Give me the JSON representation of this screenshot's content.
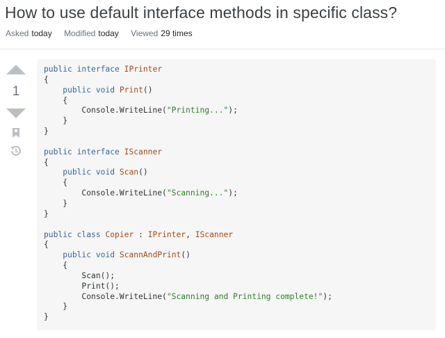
{
  "question": {
    "title": "How to use default interface methods in specific class?",
    "meta": {
      "asked_label": "Asked",
      "asked_value": "today",
      "modified_label": "Modified",
      "modified_value": "today",
      "viewed_label": "Viewed",
      "viewed_value": "29 times"
    },
    "votes": {
      "score": "1"
    },
    "colors": {
      "keyword": "#39659b",
      "type": "#a24a18",
      "string": "#2f7d2a",
      "code_bg": "#f6f6f6"
    },
    "code_lines": [
      [
        [
          "kw",
          "public"
        ],
        [
          "p",
          " "
        ],
        [
          "kw",
          "interface"
        ],
        [
          "p",
          " "
        ],
        [
          "ty",
          "IPrinter"
        ]
      ],
      [
        [
          "p",
          "{"
        ]
      ],
      [
        [
          "p",
          "    "
        ],
        [
          "kw",
          "public"
        ],
        [
          "p",
          " "
        ],
        [
          "kw",
          "void"
        ],
        [
          "p",
          " "
        ],
        [
          "ty",
          "Print"
        ],
        [
          "p",
          "()"
        ]
      ],
      [
        [
          "p",
          "    {"
        ]
      ],
      [
        [
          "p",
          "        Console.WriteLine("
        ],
        [
          "st",
          "\"Printing...\""
        ],
        [
          "p",
          ");"
        ]
      ],
      [
        [
          "p",
          "    }"
        ]
      ],
      [
        [
          "p",
          "}"
        ]
      ],
      [],
      [
        [
          "kw",
          "public"
        ],
        [
          "p",
          " "
        ],
        [
          "kw",
          "interface"
        ],
        [
          "p",
          " "
        ],
        [
          "ty",
          "IScanner"
        ]
      ],
      [
        [
          "p",
          "{"
        ]
      ],
      [
        [
          "p",
          "    "
        ],
        [
          "kw",
          "public"
        ],
        [
          "p",
          " "
        ],
        [
          "kw",
          "void"
        ],
        [
          "p",
          " "
        ],
        [
          "ty",
          "Scan"
        ],
        [
          "p",
          "()"
        ]
      ],
      [
        [
          "p",
          "    {"
        ]
      ],
      [
        [
          "p",
          "        Console.WriteLine("
        ],
        [
          "st",
          "\"Scanning...\""
        ],
        [
          "p",
          ");"
        ]
      ],
      [
        [
          "p",
          "    }"
        ]
      ],
      [
        [
          "p",
          "}"
        ]
      ],
      [],
      [
        [
          "kw",
          "public"
        ],
        [
          "p",
          " "
        ],
        [
          "kw",
          "class"
        ],
        [
          "p",
          " "
        ],
        [
          "ty",
          "Copier"
        ],
        [
          "p",
          " : "
        ],
        [
          "ty",
          "IPrinter"
        ],
        [
          "p",
          ", "
        ],
        [
          "ty",
          "IScanner"
        ]
      ],
      [
        [
          "p",
          "{"
        ]
      ],
      [
        [
          "p",
          "    "
        ],
        [
          "kw",
          "public"
        ],
        [
          "p",
          " "
        ],
        [
          "kw",
          "void"
        ],
        [
          "p",
          " "
        ],
        [
          "ty",
          "ScannAndPrint"
        ],
        [
          "p",
          "()"
        ]
      ],
      [
        [
          "p",
          "    {"
        ]
      ],
      [
        [
          "p",
          "        Scan();"
        ]
      ],
      [
        [
          "p",
          "        Print();"
        ]
      ],
      [
        [
          "p",
          "        Console.WriteLine("
        ],
        [
          "st",
          "\"Scanning and Printing complete!\""
        ],
        [
          "p",
          ");"
        ]
      ],
      [
        [
          "p",
          "    }"
        ]
      ],
      [
        [
          "p",
          "}"
        ]
      ]
    ],
    "icons": {
      "upvote": "upvote-triangle-icon",
      "downvote": "downvote-triangle-icon",
      "bookmark": "bookmark-icon",
      "history": "history-icon"
    }
  }
}
